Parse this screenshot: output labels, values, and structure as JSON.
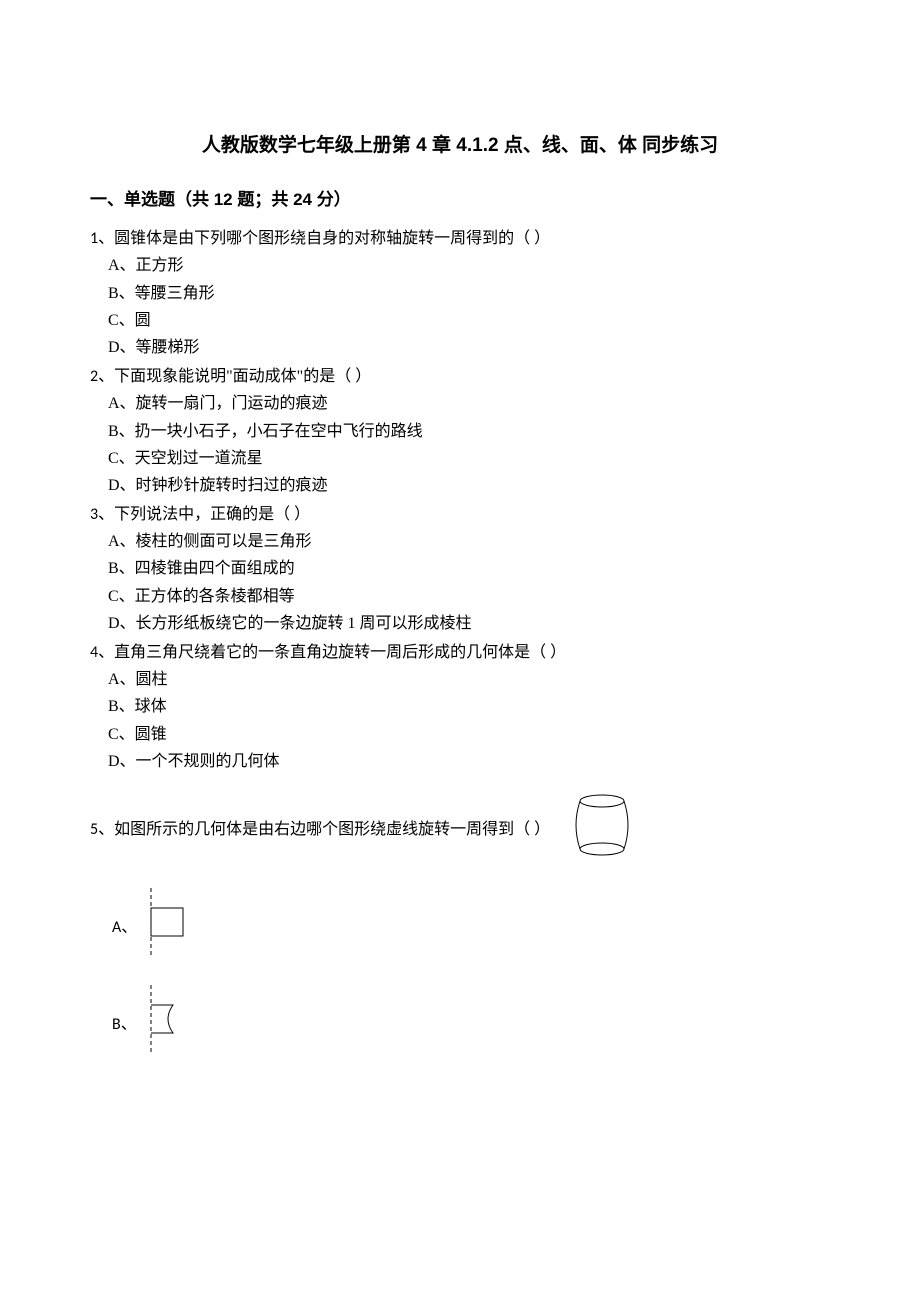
{
  "title": "人教版数学七年级上册第 4 章  4.1.2 点、线、面、体  同步练习",
  "section": "一、单选题（共 12 题；共 24 分）",
  "questions": [
    {
      "num": "1、",
      "text": "圆锥体是由下列哪个图形绕自身的对称轴旋转一周得到的（    ）",
      "options": [
        "A、正方形",
        "B、等腰三角形",
        "C、圆",
        "D、等腰梯形"
      ]
    },
    {
      "num": "2、",
      "text": "下面现象能说明\"面动成体\"的是（    ）",
      "options": [
        "A、旋转一扇门，门运动的痕迹",
        "B、扔一块小石子，小石子在空中飞行的路线",
        "C、天空划过一道流星",
        "D、时钟秒针旋转时扫过的痕迹"
      ]
    },
    {
      "num": "3、",
      "text": "下列说法中，正确的是（    ）",
      "options": [
        "A、棱柱的侧面可以是三角形",
        "B、四棱锥由四个面组成的",
        "C、正方体的各条棱都相等",
        "D、长方形纸板绕它的一条边旋转 1 周可以形成棱柱"
      ]
    },
    {
      "num": "4、",
      "text": "直角三角尺绕着它的一条直角边旋转一周后形成的几何体是（    ）",
      "options": [
        "A、圆柱",
        "B、球体",
        "C、圆锥",
        "D、一个不规则的几何体"
      ]
    }
  ],
  "q5": {
    "num": "5、",
    "text": "如图所示的几何体是由右边哪个图形绕虚线旋转一周得到（    ）",
    "optA": "A、",
    "optB": "B、"
  }
}
